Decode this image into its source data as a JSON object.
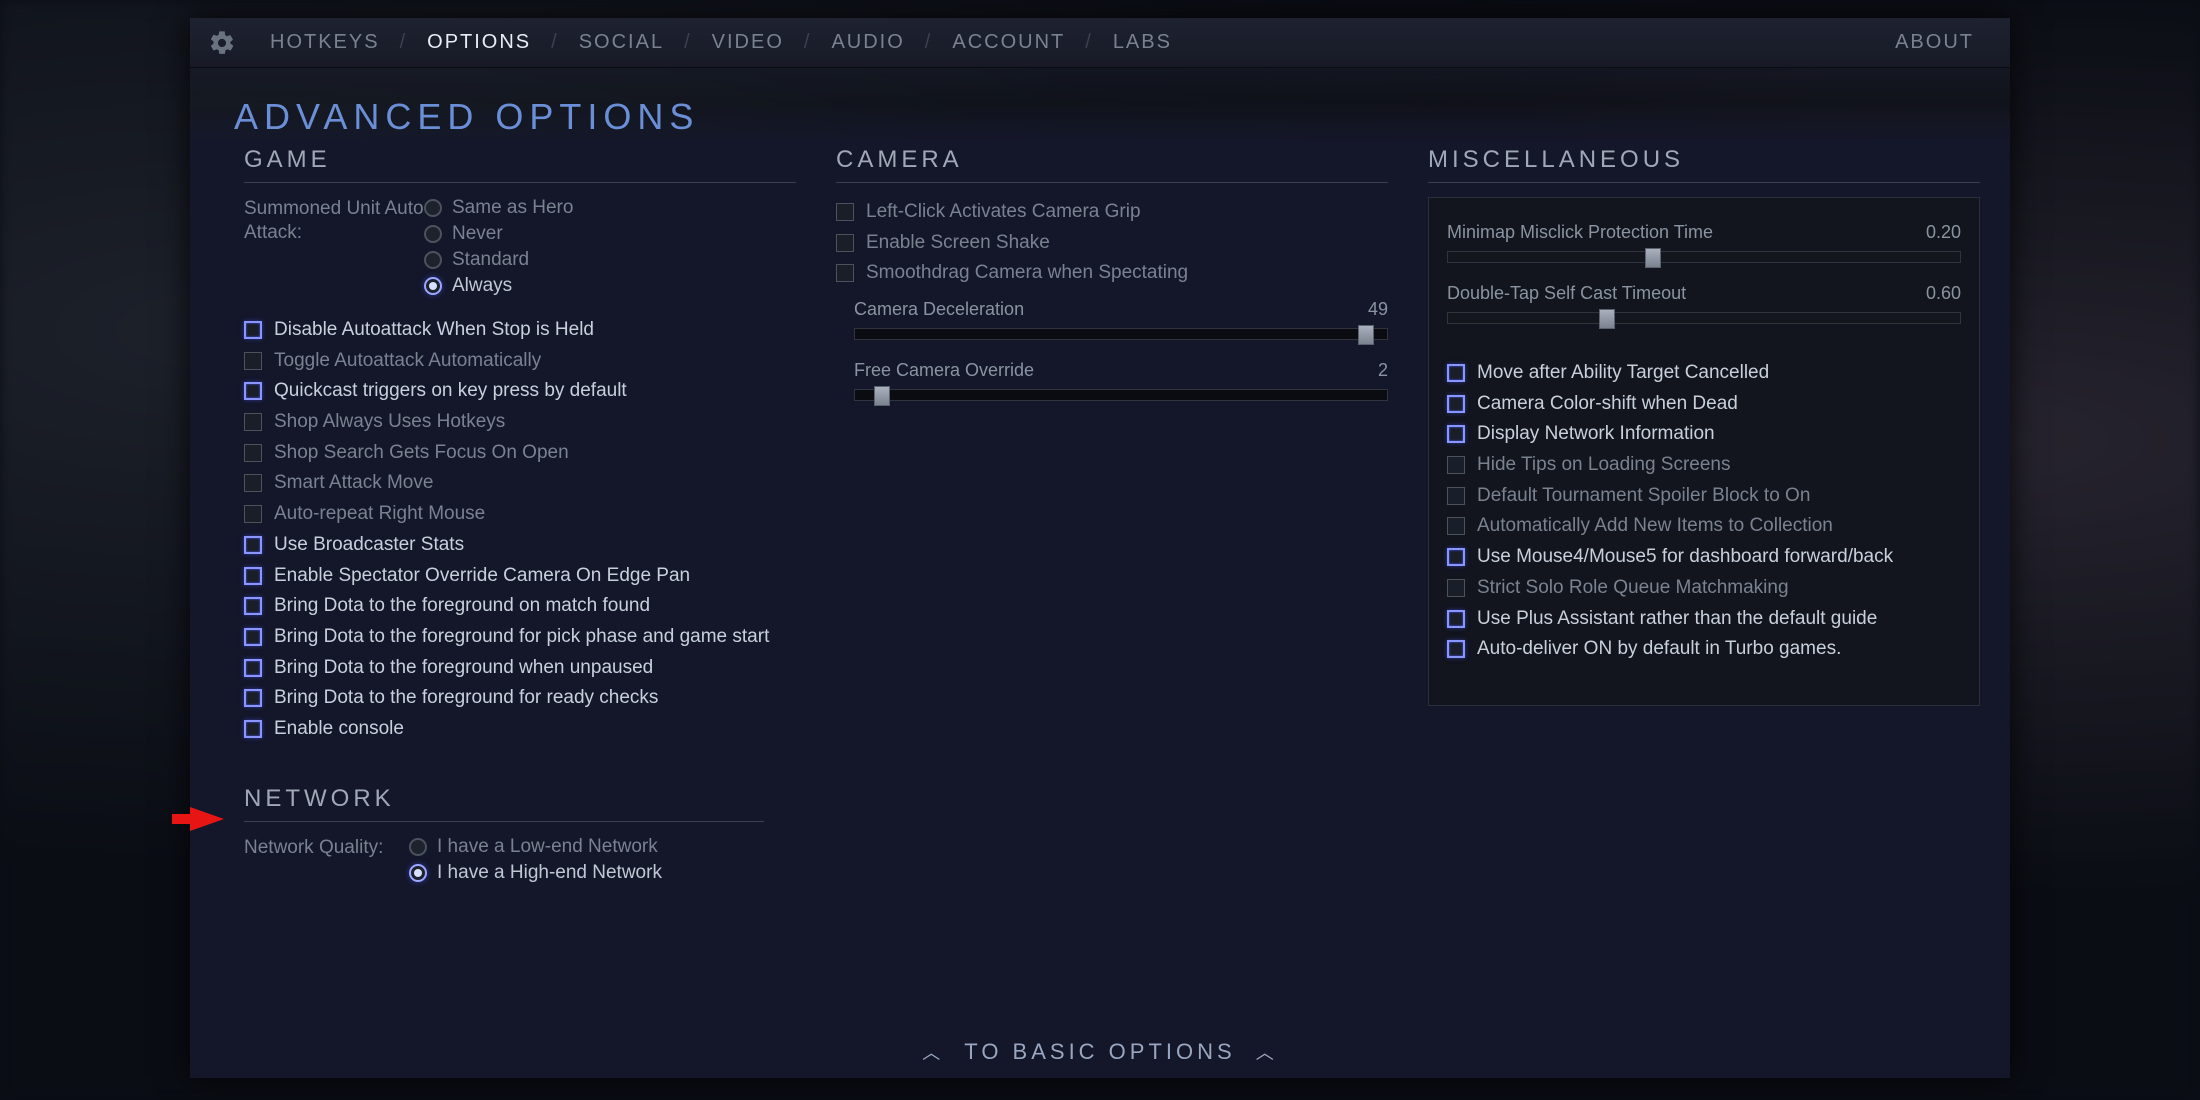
{
  "nav": {
    "items": [
      "HOTKEYS",
      "OPTIONS",
      "SOCIAL",
      "VIDEO",
      "AUDIO",
      "ACCOUNT",
      "LABS"
    ],
    "active": 1,
    "right": "ABOUT"
  },
  "page_title": "ADVANCED OPTIONS",
  "bottom_link": "TO BASIC OPTIONS",
  "game": {
    "title": "GAME",
    "summoned_label": "Summoned Unit Auto Attack:",
    "summoned_options": [
      {
        "label": "Same as Hero",
        "selected": false
      },
      {
        "label": "Never",
        "selected": false
      },
      {
        "label": "Standard",
        "selected": false
      },
      {
        "label": "Always",
        "selected": true
      }
    ],
    "checks": [
      {
        "label": "Disable Autoattack When Stop is Held",
        "on": true
      },
      {
        "label": "Toggle Autoattack Automatically",
        "on": false
      },
      {
        "label": "Quickcast triggers on key press by default",
        "on": true
      },
      {
        "label": "Shop Always Uses Hotkeys",
        "on": false
      },
      {
        "label": "Shop Search Gets Focus On Open",
        "on": false
      },
      {
        "label": "Smart Attack Move",
        "on": false
      },
      {
        "label": "Auto-repeat Right Mouse",
        "on": false
      },
      {
        "label": "Use Broadcaster Stats",
        "on": true
      },
      {
        "label": "Enable Spectator Override Camera On Edge Pan",
        "on": true
      },
      {
        "label": "Bring Dota to the foreground on match found",
        "on": true
      },
      {
        "label": "Bring Dota to the foreground for pick phase and game start",
        "on": true
      },
      {
        "label": "Bring Dota to the foreground when unpaused",
        "on": true
      },
      {
        "label": "Bring Dota to the foreground for ready checks",
        "on": true
      },
      {
        "label": "Enable console",
        "on": true
      }
    ]
  },
  "network": {
    "title": "NETWORK",
    "quality_label": "Network Quality:",
    "options": [
      {
        "label": "I have a Low-end Network",
        "selected": false
      },
      {
        "label": "I have a High-end Network",
        "selected": true
      }
    ]
  },
  "camera": {
    "title": "CAMERA",
    "checks": [
      {
        "label": "Left-Click Activates Camera Grip",
        "on": false
      },
      {
        "label": "Enable Screen Shake",
        "on": false
      },
      {
        "label": "Smoothdrag Camera when Spectating",
        "on": false
      }
    ],
    "sliders": [
      {
        "label": "Camera Deceleration",
        "value": "49",
        "pct": 96
      },
      {
        "label": "Free Camera Override",
        "value": "2",
        "pct": 5
      }
    ]
  },
  "misc": {
    "title": "MISCELLANEOUS",
    "sliders": [
      {
        "label": "Minimap Misclick Protection Time",
        "value": "0.20",
        "pct": 40
      },
      {
        "label": "Double-Tap Self Cast Timeout",
        "value": "0.60",
        "pct": 31
      }
    ],
    "checks": [
      {
        "label": "Move after Ability Target Cancelled",
        "on": true
      },
      {
        "label": "Camera Color-shift when Dead",
        "on": true
      },
      {
        "label": "Display Network Information",
        "on": true
      },
      {
        "label": "Hide Tips on Loading Screens",
        "on": false
      },
      {
        "label": "Default Tournament Spoiler Block to On",
        "on": false
      },
      {
        "label": "Automatically Add New Items to Collection",
        "on": false
      },
      {
        "label": "Use Mouse4/Mouse5 for dashboard forward/back",
        "on": true
      },
      {
        "label": "Strict Solo Role Queue Matchmaking",
        "on": false
      },
      {
        "label": "Use Plus Assistant rather than the default guide",
        "on": true
      },
      {
        "label": "Auto-deliver ON by default in Turbo games.",
        "on": true
      }
    ]
  }
}
